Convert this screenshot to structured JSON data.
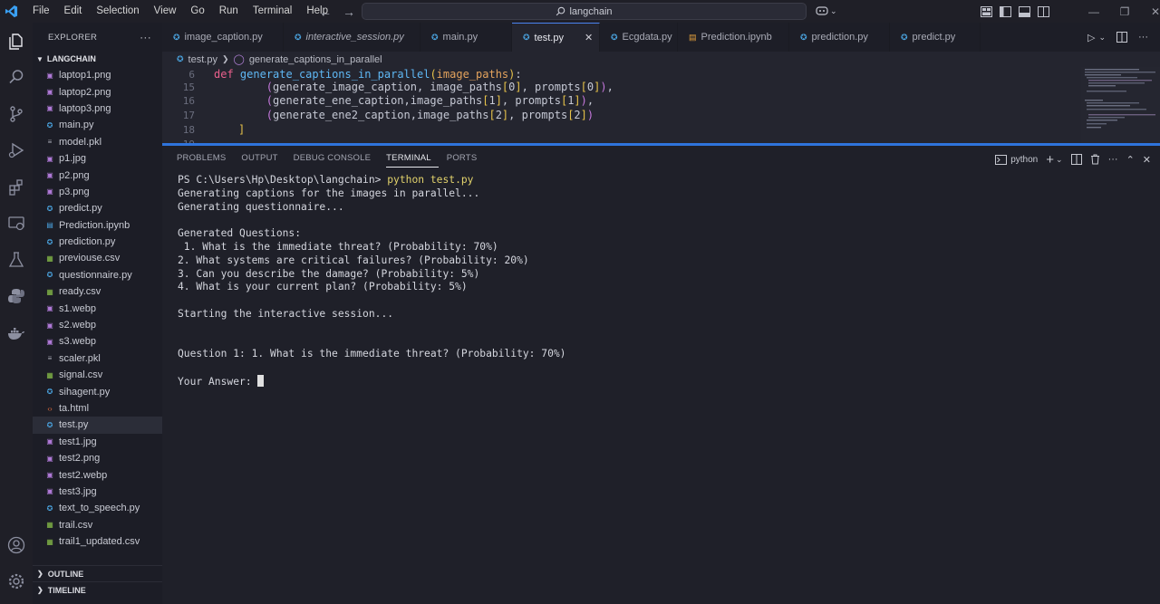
{
  "menu": [
    "File",
    "Edit",
    "Selection",
    "View",
    "Go",
    "Run",
    "Terminal",
    "Help"
  ],
  "search": {
    "text": "langchain"
  },
  "explorer": {
    "title": "EXPLORER",
    "more": "···",
    "folder": "LANGCHAIN",
    "files": [
      {
        "name": "laptop1.png",
        "type": "image"
      },
      {
        "name": "laptop2.png",
        "type": "image"
      },
      {
        "name": "laptop3.png",
        "type": "image"
      },
      {
        "name": "main.py",
        "type": "python"
      },
      {
        "name": "model.pkl",
        "type": "text"
      },
      {
        "name": "p1.jpg",
        "type": "image"
      },
      {
        "name": "p2.png",
        "type": "image"
      },
      {
        "name": "p3.png",
        "type": "image"
      },
      {
        "name": "predict.py",
        "type": "python"
      },
      {
        "name": "Prediction.ipynb",
        "type": "notebook"
      },
      {
        "name": "prediction.py",
        "type": "python"
      },
      {
        "name": "previouse.csv",
        "type": "csv"
      },
      {
        "name": "questionnaire.py",
        "type": "python"
      },
      {
        "name": "ready.csv",
        "type": "csv"
      },
      {
        "name": "s1.webp",
        "type": "image"
      },
      {
        "name": "s2.webp",
        "type": "image"
      },
      {
        "name": "s3.webp",
        "type": "image"
      },
      {
        "name": "scaler.pkl",
        "type": "text"
      },
      {
        "name": "signal.csv",
        "type": "csv"
      },
      {
        "name": "sihagent.py",
        "type": "python"
      },
      {
        "name": "ta.html",
        "type": "html"
      },
      {
        "name": "test.py",
        "type": "python",
        "active": true
      },
      {
        "name": "test1.jpg",
        "type": "image"
      },
      {
        "name": "test2.png",
        "type": "image"
      },
      {
        "name": "test2.webp",
        "type": "image"
      },
      {
        "name": "test3.jpg",
        "type": "image"
      },
      {
        "name": "text_to_speech.py",
        "type": "python"
      },
      {
        "name": "trail.csv",
        "type": "csv"
      },
      {
        "name": "trail1_updated.csv",
        "type": "csv"
      }
    ],
    "outline": "OUTLINE",
    "timeline": "TIMELINE"
  },
  "tabs": [
    {
      "label": "image_caption.py",
      "italic": false
    },
    {
      "label": "interactive_session.py",
      "italic": true
    },
    {
      "label": "main.py",
      "italic": false
    },
    {
      "label": "test.py",
      "italic": false,
      "active": true
    },
    {
      "label": "Ecgdata.py",
      "italic": false
    },
    {
      "label": "Prediction.ipynb",
      "italic": false
    },
    {
      "label": "prediction.py",
      "italic": false
    },
    {
      "label": "predict.py",
      "italic": false
    }
  ],
  "breadcrumb": {
    "file": "test.py",
    "symbol": "generate_captions_in_parallel"
  },
  "editor": {
    "lines": [
      {
        "num": "6",
        "text": "def generate_captions_in_parallel(image_paths):"
      },
      {
        "num": "15",
        "text": "(generate_image_caption, image_paths[0], prompts[0]),"
      },
      {
        "num": "16",
        "text": "(generate_ene_caption,image_paths[1], prompts[1]),"
      },
      {
        "num": "17",
        "text": "(generate_ene2_caption,image_paths[2], prompts[2])"
      },
      {
        "num": "18",
        "text": "]"
      },
      {
        "num": "19",
        "text": ""
      }
    ]
  },
  "panel": {
    "tabs": [
      "PROBLEMS",
      "OUTPUT",
      "DEBUG CONSOLE",
      "TERMINAL",
      "PORTS"
    ],
    "active_tab": "TERMINAL",
    "shell_label": "python",
    "terminal": {
      "prompt": "PS C:\\Users\\Hp\\Desktop\\langchain> ",
      "command": "python test.py",
      "output": [
        "Generating captions for the images in parallel...",
        "Generating questionnaire...",
        "",
        "Generated Questions:",
        " 1. What is the immediate threat? (Probability: 70%)",
        "2. What systems are critical failures? (Probability: 20%)",
        "3. Can you describe the damage? (Probability: 5%)",
        "4. What is your current plan? (Probability: 5%)",
        "",
        "Starting the interactive session...",
        "",
        "",
        "Question 1: 1. What is the immediate threat? (Probability: 70%)",
        ""
      ],
      "input_prompt": "Your Answer: "
    }
  },
  "colors": {
    "accent": "#2f74dc",
    "python_icon": "#4aa3df",
    "csv_icon": "#8bc34a",
    "image_icon": "#b07ad8",
    "html_icon": "#e06c3c"
  }
}
